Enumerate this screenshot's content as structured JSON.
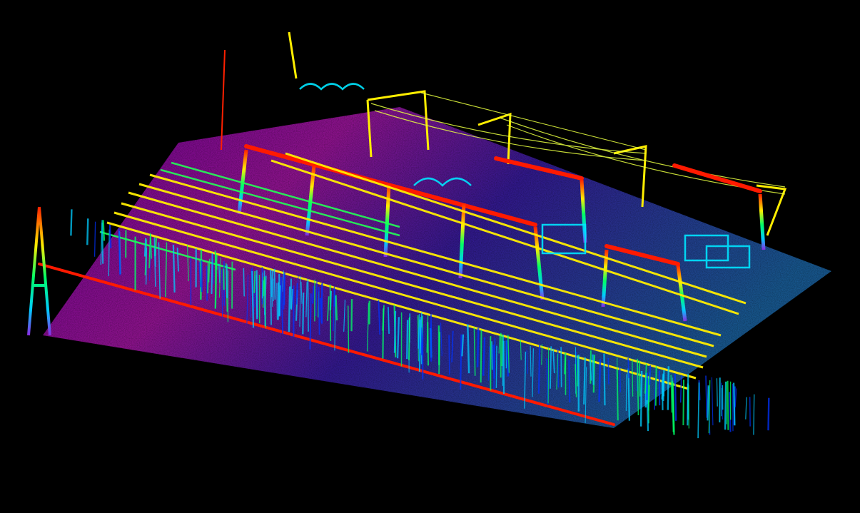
{
  "scene": {
    "kind": "point-cloud",
    "subject": "substation",
    "background_color": "#000000",
    "color_ramp": [
      "#ff00ff",
      "#8a2be2",
      "#0033ff",
      "#00ccff",
      "#00ff66",
      "#ffff00",
      "#ff0000"
    ],
    "ground_colors": [
      "#ff00ff",
      "#6a2cff",
      "#1e5bff",
      "#2a9cff"
    ],
    "gantry_color": "#ff1a00",
    "busbar_color": "#ffee00",
    "equipment_color": "#00e5ff"
  }
}
